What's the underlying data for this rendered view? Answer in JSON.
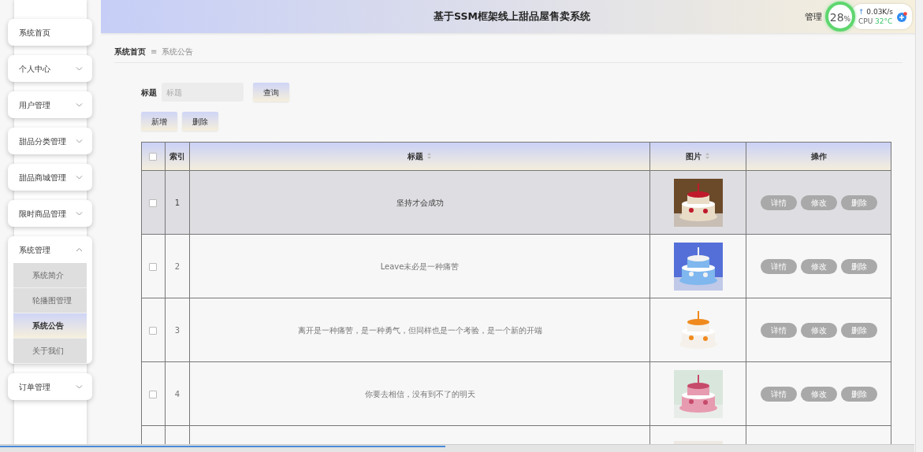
{
  "header": {
    "title": "基于SSM框架线上甜品屋售卖系统",
    "user": "管理"
  },
  "monitor": {
    "percent": "28",
    "percent_unit": "%",
    "speed_arrow": "↑",
    "speed": "0.03K/s",
    "cpu_label": "CPU",
    "cpu_temp": "32°C"
  },
  "sidebar": {
    "items": [
      {
        "label": "系统首页",
        "kind": "link"
      },
      {
        "label": "个人中心",
        "kind": "menu",
        "expanded": false
      },
      {
        "label": "用户管理",
        "kind": "menu",
        "expanded": false
      },
      {
        "label": "甜品分类管理",
        "kind": "menu",
        "expanded": false
      },
      {
        "label": "甜品商城管理",
        "kind": "menu",
        "expanded": false
      },
      {
        "label": "限时商品管理",
        "kind": "menu",
        "expanded": false
      },
      {
        "label": "系统管理",
        "kind": "menu",
        "expanded": true,
        "children": [
          {
            "label": "系统简介",
            "selected": false
          },
          {
            "label": "轮播图管理",
            "selected": false
          },
          {
            "label": "系统公告",
            "selected": true
          },
          {
            "label": "关于我们",
            "selected": false
          }
        ]
      },
      {
        "label": "订单管理",
        "kind": "menu",
        "expanded": false
      }
    ]
  },
  "breadcrumb": [
    {
      "label": "系统首页",
      "current": false
    },
    {
      "label": "系统公告",
      "current": true
    }
  ],
  "breadcrumb_separator": "≡",
  "search": {
    "label": "标题",
    "placeholder": "标题",
    "button": "查询"
  },
  "toolbar": [
    "新增",
    "删除"
  ],
  "table": {
    "select_all_checked": false,
    "columns": [
      {
        "label": "索引",
        "sortable": false
      },
      {
        "label": "标题",
        "sortable": true
      },
      {
        "label": "图片",
        "sortable": true
      },
      {
        "label": "操作",
        "sortable": false
      }
    ],
    "rows": [
      {
        "index": "1",
        "title": "坚持才会成功",
        "checked": false,
        "highlighted": true,
        "actions": [
          "详情",
          "修改",
          "删除"
        ]
      },
      {
        "index": "2",
        "title": "Leave未必是一种痛苦",
        "checked": false,
        "highlighted": false,
        "actions": [
          "详情",
          "修改",
          "删除"
        ]
      },
      {
        "index": "3",
        "title": "离开是一种痛苦，是一种勇气，但同样也是一个考验，是一个新的开端",
        "checked": false,
        "highlighted": false,
        "actions": [
          "详情",
          "修改",
          "删除"
        ]
      },
      {
        "index": "4",
        "title": "你要去相信，没有到不了的明天",
        "checked": false,
        "highlighted": false,
        "actions": [
          "详情",
          "修改",
          "删除"
        ]
      },
      {
        "highlighted": false
      }
    ]
  }
}
